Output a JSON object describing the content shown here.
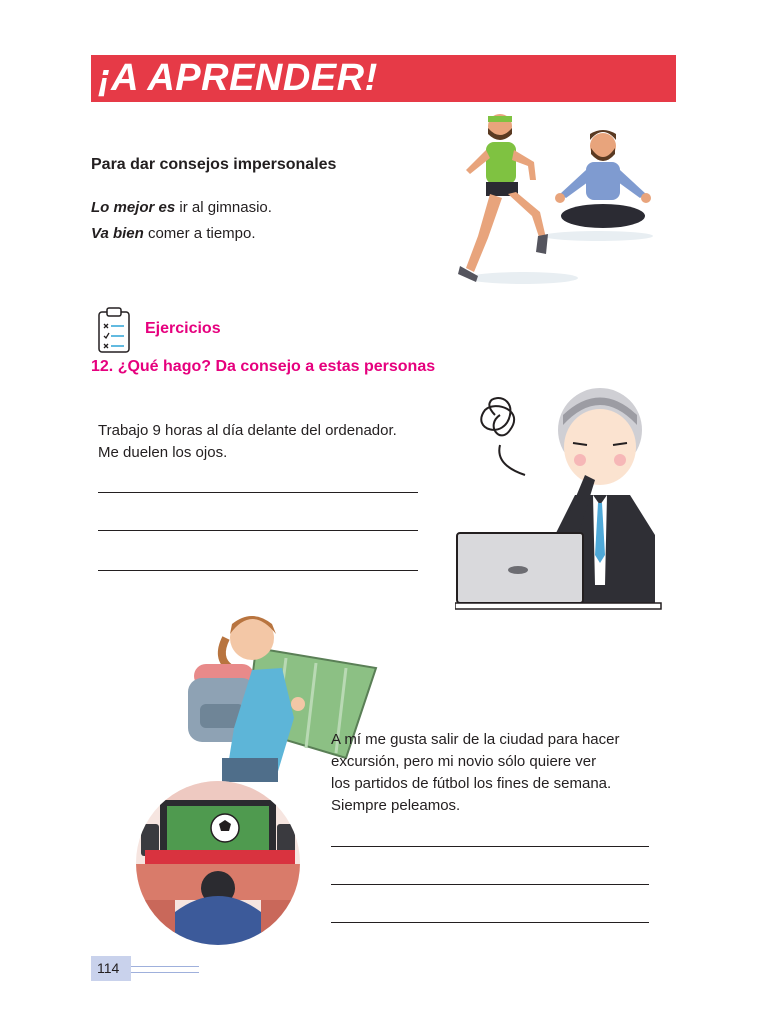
{
  "banner": {
    "title": "¡A APRENDER!"
  },
  "lesson": {
    "heading": "Para dar consejos impersonales",
    "examples": [
      {
        "emphasis": "Lo mejor es",
        "rest": " ir al gimnasio."
      },
      {
        "emphasis": "Va bien",
        "rest": " comer a tiempo."
      }
    ]
  },
  "exercises": {
    "label": "Ejercicios",
    "title": "12. ¿Qué hago? Da consejo a estas personas",
    "items": [
      {
        "lines": [
          "Trabajo 9 horas al día delante del ordenador.",
          "Me duelen los ojos."
        ]
      },
      {
        "lines": [
          "A mí me gusta salir de la ciudad para hacer",
          "excursión, pero mi novio sólo quiere ver",
          "los partidos de fútbol los fines de semana.",
          "Siempre peleamos."
        ]
      }
    ]
  },
  "footer": {
    "page_number": "114"
  },
  "colors": {
    "banner_red": "#e63a47",
    "exercise_magenta": "#e6007e",
    "page_tab": "#c9d2ec"
  }
}
